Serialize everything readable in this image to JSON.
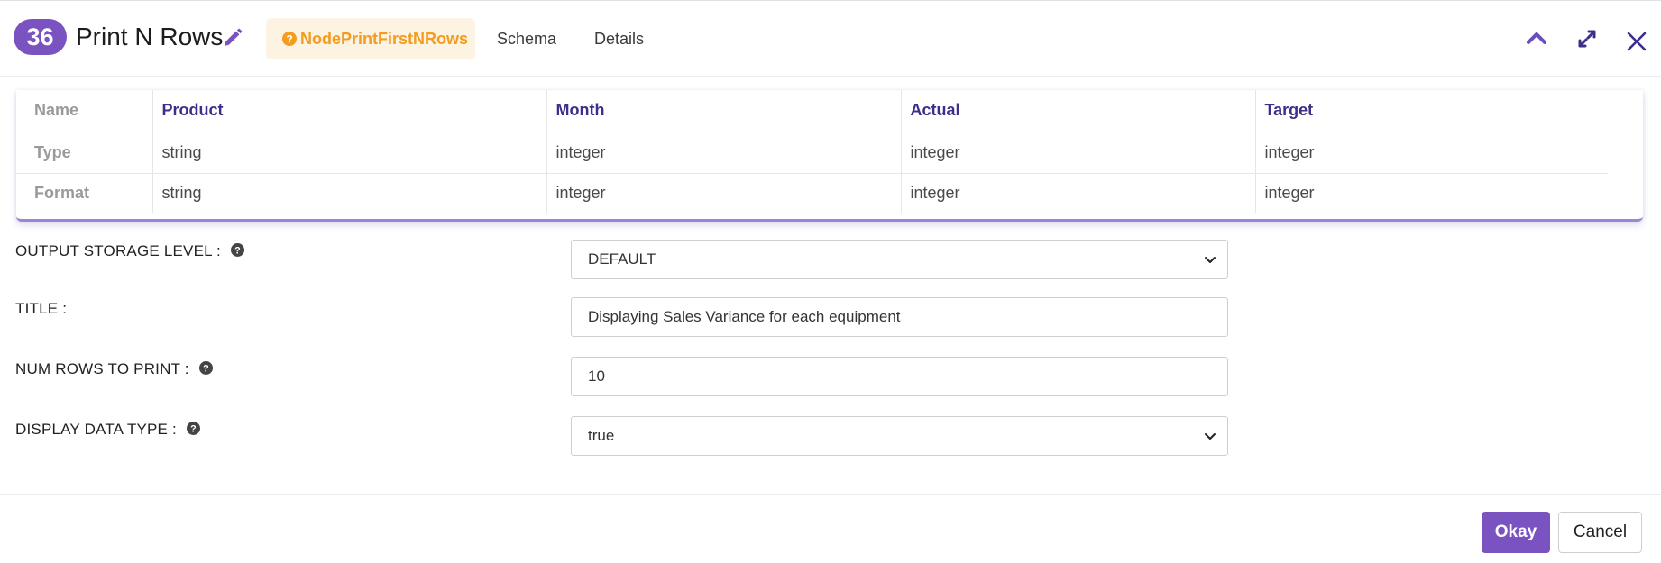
{
  "header": {
    "node_number": "36",
    "title": "Print N Rows",
    "tabs": [
      {
        "label": "NodePrintFirstNRows",
        "icon": "question-circle-icon"
      },
      {
        "label": "Schema"
      },
      {
        "label": "Details"
      }
    ],
    "actions": [
      "chevron-up-icon",
      "expand-icon",
      "close-icon"
    ]
  },
  "schema": {
    "row_labels": [
      "Name",
      "Type",
      "Format"
    ],
    "columns": [
      {
        "name": "Product",
        "type": "string",
        "format": "string"
      },
      {
        "name": "Month",
        "type": "integer",
        "format": "integer"
      },
      {
        "name": "Actual",
        "type": "integer",
        "format": "integer"
      },
      {
        "name": "Target",
        "type": "integer",
        "format": "integer"
      }
    ]
  },
  "form": {
    "output_storage_level": {
      "label": "OUTPUT STORAGE LEVEL :",
      "value": "DEFAULT",
      "has_help": true
    },
    "title": {
      "label": "TITLE :",
      "value": "Displaying Sales Variance for each equipment",
      "has_help": false
    },
    "num_rows": {
      "label": "NUM ROWS TO PRINT :",
      "value": "10",
      "has_help": true
    },
    "display_data_type": {
      "label": "DISPLAY DATA TYPE :",
      "value": "true",
      "has_help": true
    }
  },
  "footer": {
    "okay_label": "Okay",
    "cancel_label": "Cancel"
  },
  "colors": {
    "accent": "#7b53c1",
    "tab_highlight_bg": "#fdf3e3",
    "tab_highlight_text": "#f39c1f",
    "column_header": "#3d2e8c"
  }
}
